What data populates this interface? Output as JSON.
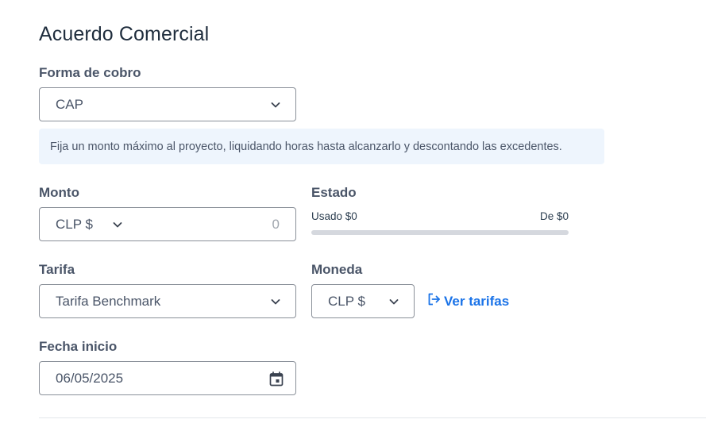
{
  "section_title": "Acuerdo Comercial",
  "forma_cobro": {
    "label": "Forma de cobro",
    "value": "CAP",
    "info": "Fija un monto máximo al proyecto, liquidando horas hasta alcanzarlo y descontando las excedentes."
  },
  "monto": {
    "label": "Monto",
    "currency": "CLP $",
    "amount_placeholder": "0"
  },
  "estado": {
    "label": "Estado",
    "usado": "Usado $0",
    "de": "De $0",
    "progress": 0
  },
  "tarifa": {
    "label": "Tarifa",
    "value": "Tarifa Benchmark"
  },
  "moneda": {
    "label": "Moneda",
    "value": "CLP $"
  },
  "ver_tarifas": "Ver tarifas",
  "fecha_inicio": {
    "label": "Fecha inicio",
    "value": "06/05/2025"
  },
  "colors": {
    "link": "#1a73e8",
    "info_bg": "#eef5fd",
    "border": "#8a9099",
    "progress_track": "#d5d8de"
  },
  "icons": [
    "chevron-down-icon",
    "external-link-icon",
    "calendar-icon"
  ]
}
